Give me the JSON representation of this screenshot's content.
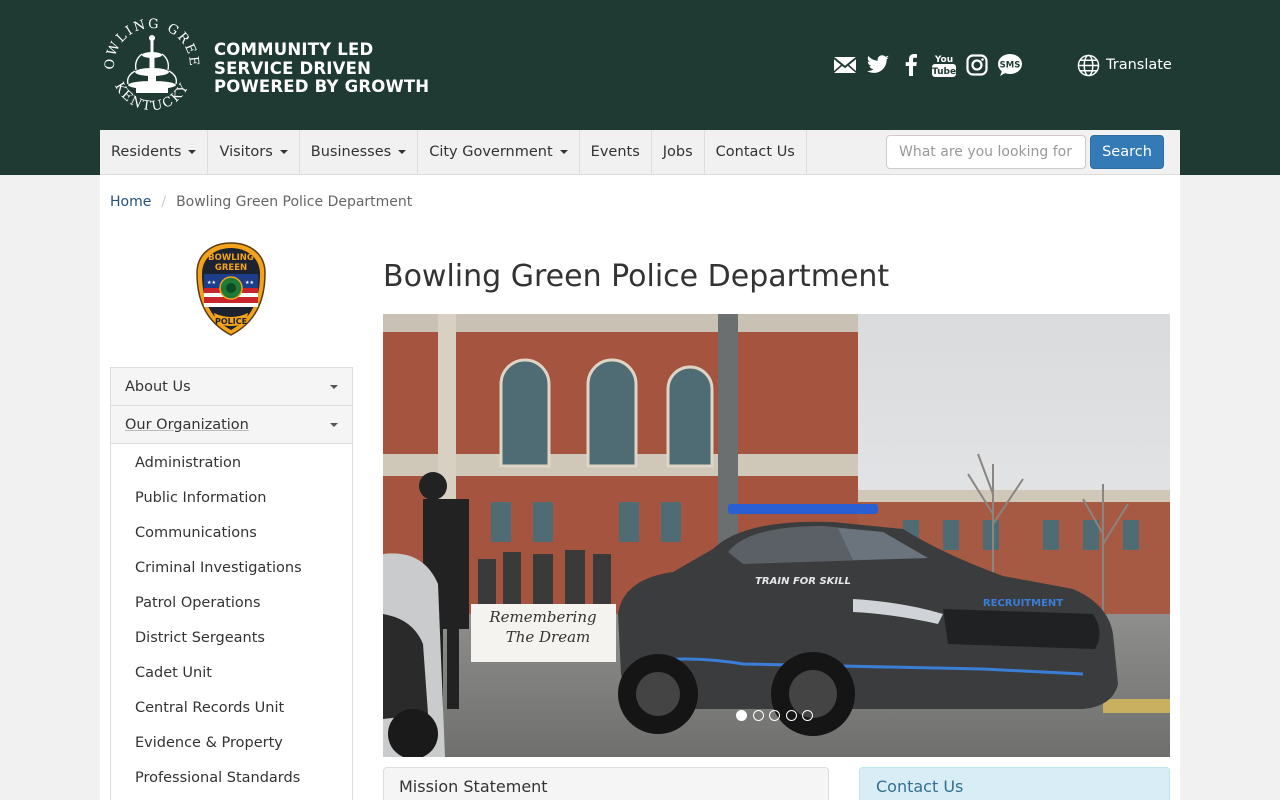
{
  "header": {
    "tagline": [
      "COMMUNITY LED",
      "SERVICE DRIVEN",
      "POWERED BY GROWTH"
    ],
    "seal_top_text": "BOWLING GREEN",
    "seal_bottom_text": "KENTUCKY",
    "translate_label": "Translate",
    "bg_color": "#1f3a33",
    "social_icons": [
      "email-icon",
      "twitter-icon",
      "facebook-icon",
      "youtube-icon",
      "instagram-icon",
      "sms-icon"
    ]
  },
  "nav": {
    "items": [
      {
        "label": "Residents",
        "dropdown": true
      },
      {
        "label": "Visitors",
        "dropdown": true
      },
      {
        "label": "Businesses",
        "dropdown": true
      },
      {
        "label": "City Government",
        "dropdown": true
      },
      {
        "label": "Events",
        "dropdown": false
      },
      {
        "label": "Jobs",
        "dropdown": false
      },
      {
        "label": "Contact Us",
        "dropdown": false
      }
    ],
    "search_placeholder": "What are you looking for",
    "search_button": "Search",
    "accent_color": "#337ab7"
  },
  "breadcrumb": {
    "home": "Home",
    "current": "Bowling Green Police Department"
  },
  "badge": {
    "top": "BOWLING",
    "middle": "GREEN",
    "bottom": "POLICE"
  },
  "sidenav": {
    "about": "About Us",
    "org": "Our Organization",
    "items": [
      "Administration",
      "Public Information",
      "Communications",
      "Criminal Investigations",
      "Patrol Operations",
      "District Sergeants",
      "Cadet Unit",
      "Central Records Unit",
      "Evidence & Property",
      "Professional Standards"
    ]
  },
  "main": {
    "title": "Bowling Green Police Department",
    "hero": {
      "banner_line1": "Remembering",
      "banner_line2": "The Dream",
      "car_text1": "TRAIN FOR SKILL",
      "car_text2": "RECRUITMENT",
      "slides": 5,
      "active_slide": 1
    },
    "mission_heading": "Mission Statement",
    "contact_heading": "Contact Us"
  }
}
